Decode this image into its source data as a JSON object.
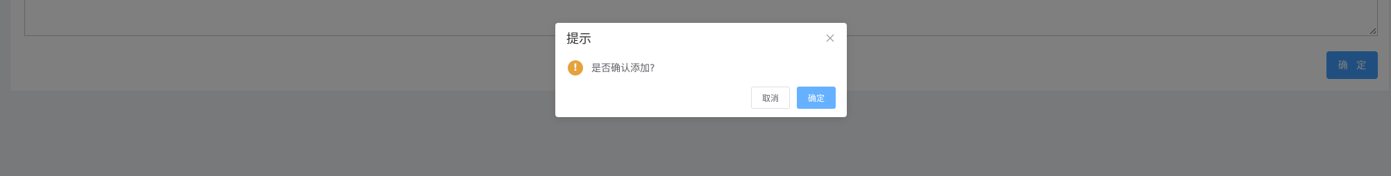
{
  "page": {
    "confirm_label": "确 定"
  },
  "dialog": {
    "title": "提示",
    "message": "是否确认添加?",
    "icon": "warning-icon",
    "icon_glyph": "!",
    "cancel_label": "取消",
    "ok_label": "确定"
  },
  "colors": {
    "primary": "#409eff",
    "primary_light": "#66b1ff",
    "warning": "#e6a23c",
    "overlay": "rgba(0,0,0,0.5)"
  }
}
